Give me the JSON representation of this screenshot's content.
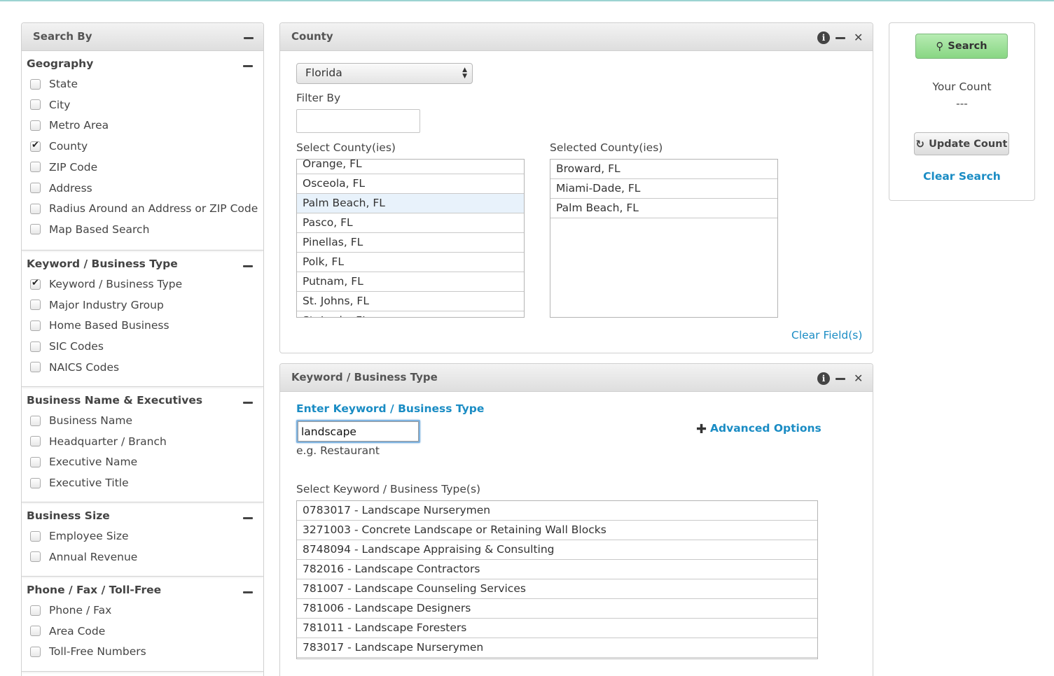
{
  "sidebar": {
    "title": "Search By",
    "groups": [
      {
        "title": "Geography",
        "items": [
          {
            "label": "State",
            "checked": false
          },
          {
            "label": "City",
            "checked": false
          },
          {
            "label": "Metro Area",
            "checked": false
          },
          {
            "label": "County",
            "checked": true
          },
          {
            "label": "ZIP Code",
            "checked": false
          },
          {
            "label": "Address",
            "checked": false
          },
          {
            "label": "Radius Around an Address or ZIP Code",
            "checked": false
          },
          {
            "label": "Map Based Search",
            "checked": false
          }
        ]
      },
      {
        "title": "Keyword / Business Type",
        "items": [
          {
            "label": "Keyword / Business Type",
            "checked": true
          },
          {
            "label": "Major Industry Group",
            "checked": false
          },
          {
            "label": "Home Based Business",
            "checked": false
          },
          {
            "label": "SIC Codes",
            "checked": false
          },
          {
            "label": "NAICS Codes",
            "checked": false
          }
        ]
      },
      {
        "title": "Business Name & Executives",
        "items": [
          {
            "label": "Business Name",
            "checked": false
          },
          {
            "label": "Headquarter / Branch",
            "checked": false
          },
          {
            "label": "Executive Name",
            "checked": false
          },
          {
            "label": "Executive Title",
            "checked": false
          }
        ]
      },
      {
        "title": "Business Size",
        "items": [
          {
            "label": "Employee Size",
            "checked": false
          },
          {
            "label": "Annual Revenue",
            "checked": false
          }
        ]
      },
      {
        "title": "Phone / Fax / Toll-Free",
        "items": [
          {
            "label": "Phone / Fax",
            "checked": false
          },
          {
            "label": "Area Code",
            "checked": false
          },
          {
            "label": "Toll-Free Numbers",
            "checked": false
          }
        ]
      }
    ]
  },
  "county": {
    "title": "County",
    "state_value": "Florida",
    "filter_label": "Filter By",
    "filter_value": "",
    "select_label": "Select County(ies)",
    "selected_label": "Selected County(ies)",
    "available": [
      "Orange, FL",
      "Osceola, FL",
      "Palm Beach, FL",
      "Pasco, FL",
      "Pinellas, FL",
      "Polk, FL",
      "Putnam, FL",
      "St. Johns, FL",
      "St. Lucie, FL"
    ],
    "highlighted_index": 2,
    "selected": [
      "Broward, FL",
      "Miami-Dade, FL",
      "Palm Beach, FL"
    ],
    "clear_label": "Clear Field(s)"
  },
  "keyword": {
    "title": "Keyword / Business Type",
    "enter_label": "Enter Keyword / Business Type",
    "input_value": "landscape",
    "example": "e.g. Restaurant",
    "advanced_label": "Advanced Options",
    "select_label": "Select Keyword / Business Type(s)",
    "results": [
      "0783017 - Landscape Nurserymen",
      "3271003 - Concrete Landscape or Retaining Wall Blocks",
      "8748094 - Landscape Appraising & Consulting",
      "782016 - Landscape Contractors",
      "781007 - Landscape Counseling Services",
      "781006 - Landscape Designers",
      "781011 - Landscape Foresters",
      "783017 - Landscape Nurserymen"
    ]
  },
  "searchbox": {
    "search_label": "Search",
    "count_label": "Your Count",
    "count_value": "---",
    "update_label": "Update Count",
    "clear_label": "Clear Search"
  },
  "icons": {
    "search": "search-icon",
    "refresh": "refresh-icon",
    "info": "info-icon",
    "close": "close-icon",
    "minus": "minus-icon",
    "plus": "plus-icon",
    "select_arrows": "select-arrows-icon"
  },
  "colors": {
    "link": "#1a8cc4",
    "search_button": "#88d683",
    "highlight_row": "#e8f2fb"
  }
}
